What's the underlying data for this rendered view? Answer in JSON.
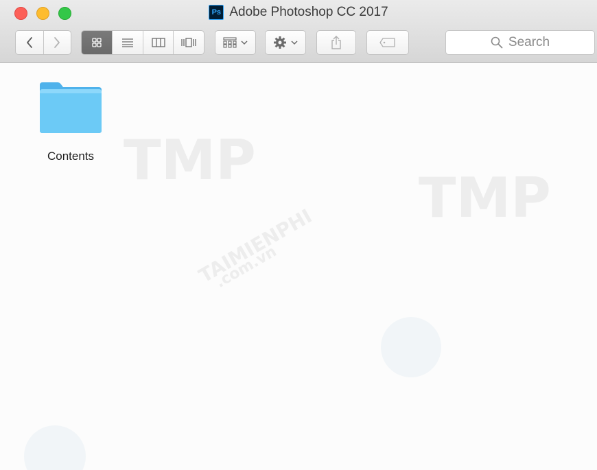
{
  "window": {
    "title": "Adobe Photoshop CC 2017",
    "title_icon": "photoshop-app-icon",
    "title_icon_text": "Ps"
  },
  "traffic_lights": [
    {
      "name": "close",
      "color": "#fc5f57"
    },
    {
      "name": "minimize",
      "color": "#fdbc2e"
    },
    {
      "name": "zoom",
      "color": "#33c748"
    }
  ],
  "toolbar": {
    "nav": [
      "chevron-left-icon",
      "chevron-right-icon"
    ],
    "view_modes": [
      "icon-view-icon",
      "list-view-icon",
      "column-view-icon",
      "cover-flow-icon"
    ],
    "active_view": "icon-view-icon",
    "arrange_icon": "group-grid-icon",
    "action_icon": "gear-icon",
    "share_icon": "share-icon",
    "tags_icon": "tag-icon"
  },
  "search": {
    "placeholder": "Search",
    "icon": "magnifier-icon"
  },
  "files": [
    {
      "name": "Contents",
      "kind": "folder",
      "icon": "folder-icon",
      "color": "#5fc0f3"
    }
  ],
  "watermark_texts": [
    "TMP",
    "TMP",
    "TAIMIENPHI",
    ".com.vn"
  ]
}
